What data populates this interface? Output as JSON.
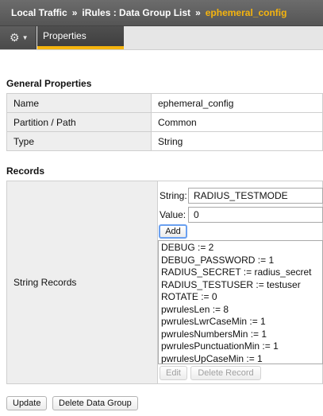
{
  "breadcrumb": {
    "items": [
      "Local Traffic",
      "iRules : Data Group List"
    ],
    "separator": "»",
    "current": "ephemeral_config"
  },
  "tabbar": {
    "menu_icon": "gear-icon",
    "active_tab": "Properties"
  },
  "general": {
    "title": "General Properties",
    "rows": [
      {
        "label": "Name",
        "value": "ephemeral_config"
      },
      {
        "label": "Partition / Path",
        "value": "Common"
      },
      {
        "label": "Type",
        "value": "String"
      }
    ]
  },
  "records": {
    "title": "Records",
    "label": "String Records",
    "string_label": "String:",
    "string_value": "RADIUS_TESTMODE",
    "value_label": "Value:",
    "value_value": "0",
    "add_button": "Add",
    "items": [
      "DEBUG := 2",
      "DEBUG_PASSWORD := 1",
      "RADIUS_SECRET := radius_secret",
      "RADIUS_TESTUSER := testuser",
      "ROTATE := 0",
      "pwrulesLen := 8",
      "pwrulesLwrCaseMin := 1",
      "pwrulesNumbersMin := 1",
      "pwrulesPunctuationMin := 1",
      "pwrulesUpCaseMin := 1"
    ],
    "edit_button": "Edit",
    "delete_button": "Delete Record"
  },
  "footer": {
    "update_button": "Update",
    "delete_group_button": "Delete Data Group"
  },
  "colors": {
    "accent": "#f5b40e",
    "header_bg": "#5e5e5e",
    "label_bg": "#eeeeee",
    "focus_ring": "#6aa0f0"
  }
}
